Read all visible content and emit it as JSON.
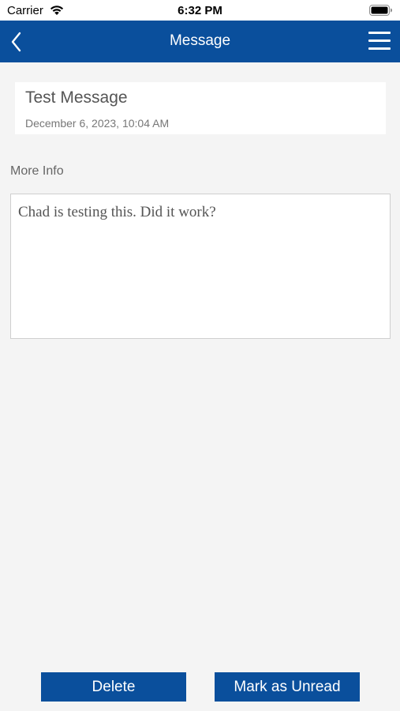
{
  "status_bar": {
    "carrier": "Carrier",
    "time": "6:32 PM",
    "wifi_icon": "wifi-icon",
    "battery_icon": "battery-icon"
  },
  "nav": {
    "title": "Message",
    "back_icon": "chevron-left-icon",
    "menu_icon": "hamburger-menu-icon",
    "background_color": "#0a4f9c"
  },
  "message": {
    "title": "Test Message",
    "date": "December 6, 2023, 10:04 AM",
    "more_info_label": "More Info",
    "body": "Chad is testing this. Did it work?"
  },
  "actions": {
    "delete_label": "Delete",
    "mark_unread_label": "Mark as Unread",
    "button_color": "#0a4f9c"
  }
}
